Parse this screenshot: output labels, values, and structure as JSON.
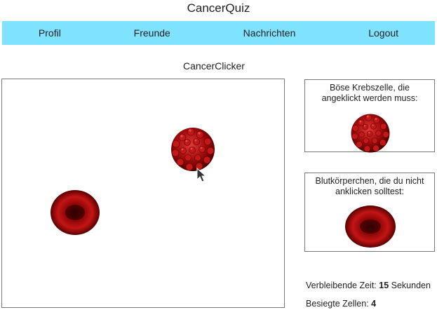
{
  "app": {
    "title": "CancerQuiz"
  },
  "nav": {
    "items": [
      {
        "label": "Profil"
      },
      {
        "label": "Freunde"
      },
      {
        "label": "Nachrichten"
      },
      {
        "label": "Logout"
      }
    ]
  },
  "game": {
    "title": "CancerClicker"
  },
  "info": {
    "cancer_text": "Böse Krebszelle, die angeklickt werden muss:",
    "blood_text": "Blutkörperchen, die du nicht anklicken solltest:"
  },
  "stats": {
    "time_label": "Verbleibende Zeit:",
    "time_value": "15",
    "time_unit": "Sekunden",
    "kills_label": "Besiegte Zellen:",
    "kills_value": "4"
  },
  "colors": {
    "nav_bg": "#7fe3ff",
    "cell_red": "#b00000",
    "cell_dark": "#5a0000"
  },
  "icons": {
    "cancer_cell": "cancer-cell-icon",
    "blood_cell": "blood-cell-icon",
    "cursor": "mouse-pointer-icon"
  }
}
